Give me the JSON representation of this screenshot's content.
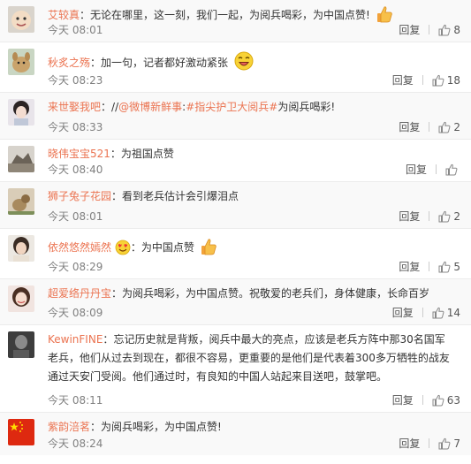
{
  "labels": {
    "reply": "回复"
  },
  "comments": [
    {
      "user": "艾较真",
      "sep": "：",
      "text": "无论在哪里，这一刻，我们一起，为阅兵喝彩，为中国点赞!",
      "time": "今天 08:01",
      "likes": "8"
    },
    {
      "user": "秋炙之殇",
      "sep": "：",
      "text": "加一句，记者都好激动紧张",
      "time": "今天 08:23",
      "likes": "18"
    },
    {
      "user": "来世娶我吧",
      "sep": "：",
      "prefix": "//",
      "mention": "@微博新鲜事",
      "sep2": ":",
      "hashtag": "#指尖护卫大阅兵#",
      "text": "为阅兵喝彩!",
      "time": "今天 08:33",
      "likes": "2"
    },
    {
      "user": "晓伟宝宝521",
      "sep": "：",
      "text": "为祖国点赞",
      "time": "今天 08:40",
      "likes": ""
    },
    {
      "user": "狮子兔子花园",
      "sep": "：",
      "text": "看到老兵估计会引爆泪点",
      "time": "今天 08:01",
      "likes": "2"
    },
    {
      "user": "依然悠然嫣然",
      "sep": "：",
      "text": "为中国点赞",
      "time": "今天 08:29",
      "likes": "5"
    },
    {
      "user": "超爱络丹丹宝",
      "sep": "：",
      "text": "为阅兵喝彩，为中国点赞。祝敬爱的老兵们，身体健康，长命百岁",
      "time": "今天 08:09",
      "likes": "14"
    },
    {
      "user": "KewinFINE",
      "sep": "：",
      "text": "忘记历史就是背叛，阅兵中最大的亮点，应该是老兵方阵中那30名国军老兵，他们从过去到现在，都很不容易，更重要的是他们是代表着300多万牺牲的战友通过天安门受阅。他们通过时，有良知的中国人站起来目送吧，鼓掌吧。",
      "time": "今天 08:11",
      "likes": "63"
    },
    {
      "user": "紫韵涪茗",
      "sep": "：",
      "text": "为阅兵喝彩，为中国点赞!",
      "time": "今天 08:24",
      "likes": "7"
    }
  ]
}
